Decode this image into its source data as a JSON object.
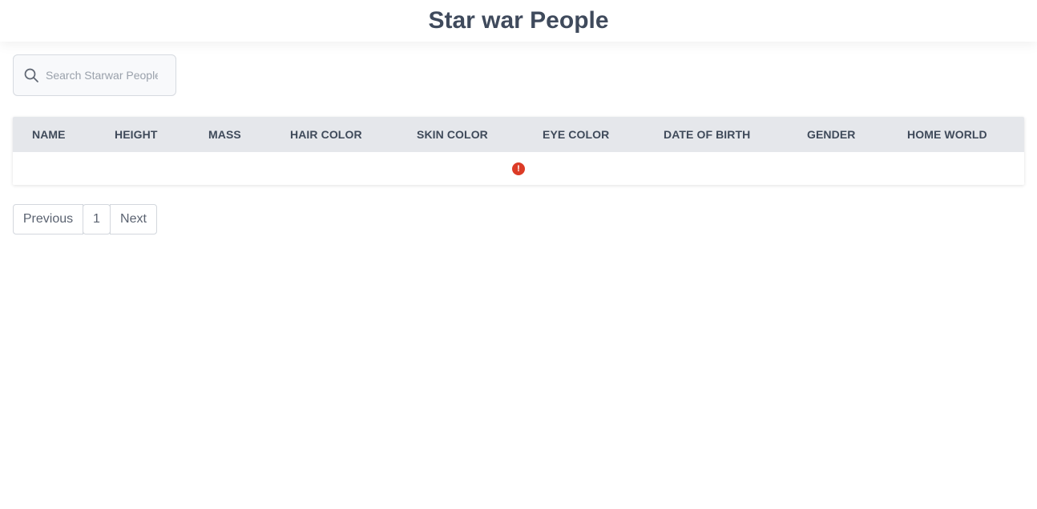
{
  "header": {
    "title": "Star war People"
  },
  "search": {
    "placeholder": "Search Starwar People",
    "value": "",
    "icon": "search-icon"
  },
  "table": {
    "columns": [
      "NAME",
      "HEIGHT",
      "MASS",
      "HAIR COLOR",
      "SKIN COLOR",
      "EYE COLOR",
      "DATE OF BIRTH",
      "GENDER",
      "HOME WORLD"
    ],
    "rows": [],
    "status_icon": "error-icon",
    "status_glyph": "!",
    "status_color": "#dc3b26"
  },
  "pagination": {
    "previous_label": "Previous",
    "current_page": "1",
    "next_label": "Next"
  },
  "colors": {
    "header_bg": "#e5e7eb",
    "text": "#3f4a5a",
    "error": "#dc3b26"
  }
}
